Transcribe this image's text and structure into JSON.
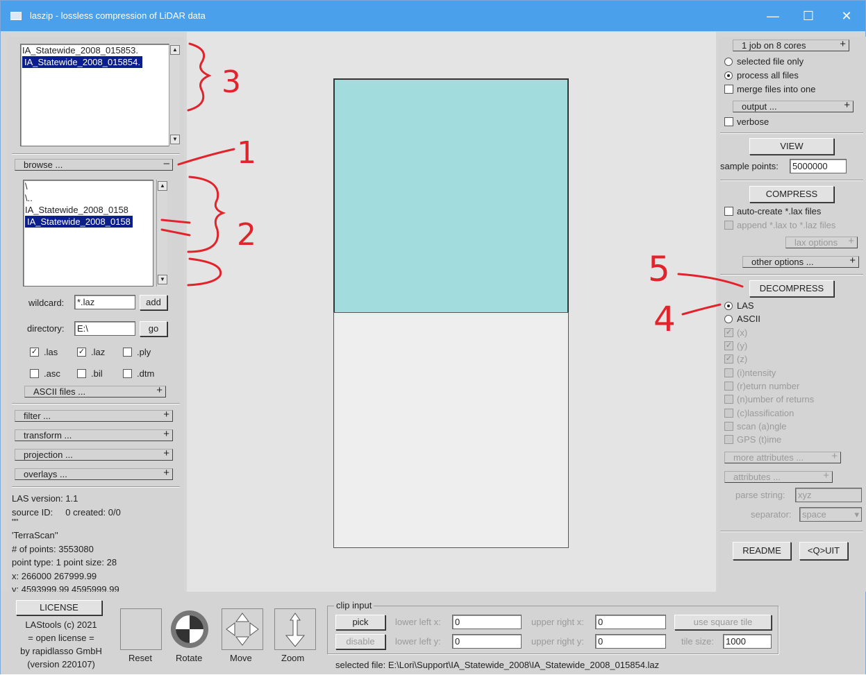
{
  "window": {
    "title": "laszip - lossless compression of LiDAR data",
    "minimize": "—",
    "maximize": "☐",
    "close": "✕"
  },
  "left": {
    "file_list": [
      "IA_Statewide_2008_015853.",
      "IA_Statewide_2008_015854."
    ],
    "browse": "browse ...",
    "dir_list": [
      "\\",
      "\\..",
      "IA_Statewide_2008_0158",
      "IA_Statewide_2008_0158"
    ],
    "wildcard_label": "wildcard:",
    "wildcard_value": "*.laz",
    "add": "add",
    "directory_label": "directory:",
    "directory_value": "E:\\",
    "go": "go",
    "ext": {
      "las": ".las",
      "laz": ".laz",
      "ply": ".ply",
      "asc": ".asc",
      "bil": ".bil",
      "dtm": ".dtm"
    },
    "ascii_files": "ASCII files ...",
    "filter": "filter ...",
    "transform": "transform ...",
    "projection": "projection ...",
    "overlays": "overlays ...",
    "info": [
      "LAS version: 1.1",
      "source ID:     0 created: 0/0",
      "\"\"",
      "'TerraScan''",
      "# of points: 3553080",
      "point type: 1 point size: 28",
      "x: 266000 267999.99",
      "y: 4593999.99 4595999.99"
    ]
  },
  "right": {
    "jobs": "1 job on 8 cores",
    "selected_only": "selected file only",
    "process_all": "process all files",
    "merge": "merge files into one",
    "output": "output ...",
    "verbose": "verbose",
    "view": "VIEW",
    "sample_label": "sample points:",
    "sample_value": "5000000",
    "compress": "COMPRESS",
    "auto_lax": "auto-create *.lax files",
    "append_lax": "append *.lax to *.laz files",
    "lax_options": "lax options",
    "other_options": "other options ...",
    "decompress": "DECOMPRESS",
    "las": "LAS",
    "ascii": "ASCII",
    "attrs": [
      "(x)",
      "(y)",
      "(z)",
      "(i)ntensity",
      "(r)eturn number",
      "(n)umber of returns",
      "(c)lassification",
      "scan (a)ngle",
      "GPS (t)ime"
    ],
    "more_attributes": "more attributes ...",
    "attributes": "attributes ...",
    "parse_label": "parse string:",
    "parse_value": "xyz",
    "separator_label": "separator:",
    "separator_value": "space",
    "readme": "README",
    "quit": "<Q>UIT"
  },
  "bottom": {
    "license": "LICENSE",
    "credits": [
      "LAStools (c) 2021",
      "= open license =",
      "by rapidlasso GmbH",
      "(version 220107)"
    ],
    "reset": "Reset",
    "rotate": "Rotate",
    "move": "Move",
    "zoom": "Zoom",
    "clip_input": "clip input",
    "pick": "pick",
    "disable": "disable",
    "lower_left_x": "lower left x:",
    "lower_left_y": "lower left y:",
    "upper_right_x": "upper right x:",
    "upper_right_y": "upper right y:",
    "ll_x": "0",
    "ll_y": "0",
    "ur_x": "0",
    "ur_y": "0",
    "use_square_tile": "use square tile",
    "tile_size_label": "tile size:",
    "tile_size": "1000",
    "selected_file": "selected file: E:\\Lori\\Support\\IA_Statewide_2008\\IA_Statewide_2008_015854.laz"
  },
  "annotations": [
    "3",
    "1",
    "2",
    "5",
    "4"
  ],
  "colors": {
    "tile_selected": "#a3dcdc",
    "tile_other": "#eeeeee",
    "annotation": "#e2232b",
    "title_bar": "#4aa0ea"
  }
}
